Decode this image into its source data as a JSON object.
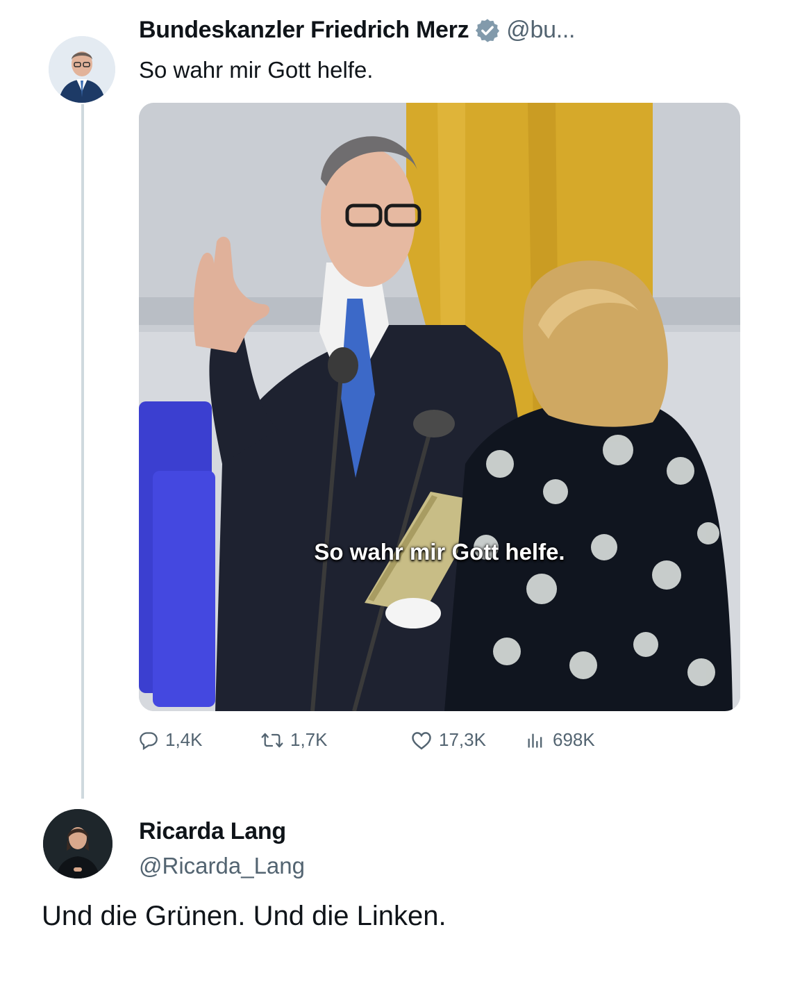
{
  "original_tweet": {
    "author_name": "Bundeskanzler Friedrich Merz",
    "handle": "@bu...",
    "text": "So wahr mir Gott helfe.",
    "media_subtitle": "So wahr mir Gott helfe.",
    "metrics": {
      "replies": "1,4K",
      "reposts": "1,7K",
      "likes": "17,3K",
      "views": "698K"
    }
  },
  "reply_tweet": {
    "author_name": "Ricarda Lang",
    "handle": "@Ricarda_Lang",
    "text": "Und die Grünen. Und die Linken."
  },
  "colors": {
    "verified": "#829aab",
    "secondary_text": "#536471",
    "thread_line": "#cfd9de"
  },
  "icons": [
    "verified-badge-icon",
    "reply-icon",
    "repost-icon",
    "like-icon",
    "views-icon"
  ]
}
